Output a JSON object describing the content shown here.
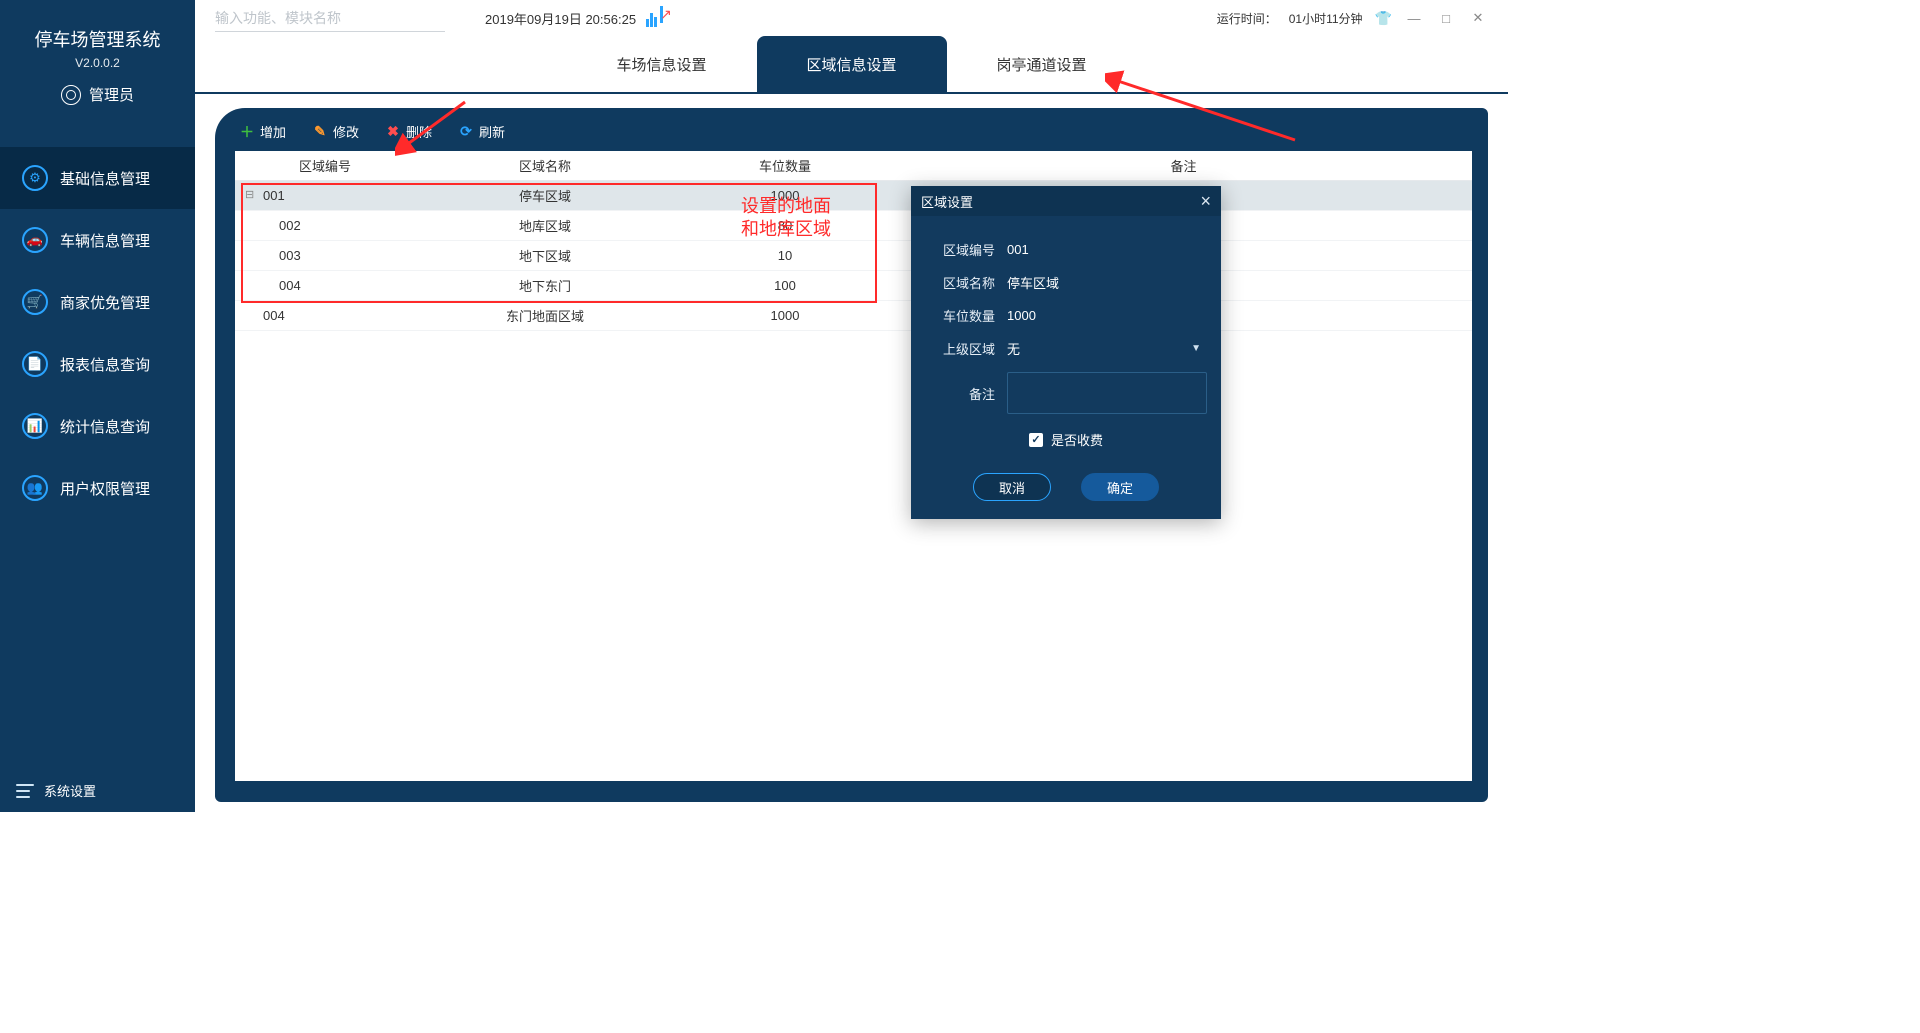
{
  "app": {
    "title": "停车场管理系统",
    "version": "V2.0.0.2",
    "user_role": "管理员"
  },
  "topbar": {
    "search_placeholder": "输入功能、模块名称",
    "datetime": "2019年09月19日 20:56:25",
    "runtime_label": "运行时间：",
    "runtime_value": "01小时11分钟"
  },
  "tabs": {
    "items": [
      "车场信息设置",
      "区域信息设置",
      "岗亭通道设置"
    ],
    "active_index": 1
  },
  "sidebar": {
    "items": [
      {
        "label": "基础信息管理",
        "icon": "gear"
      },
      {
        "label": "车辆信息管理",
        "icon": "car"
      },
      {
        "label": "商家优免管理",
        "icon": "cart"
      },
      {
        "label": "报表信息查询",
        "icon": "report"
      },
      {
        "label": "统计信息查询",
        "icon": "stats"
      },
      {
        "label": "用户权限管理",
        "icon": "users"
      }
    ],
    "active_index": 0,
    "footer_label": "系统设置"
  },
  "toolbar": {
    "add": "增加",
    "edit": "修改",
    "delete": "删除",
    "refresh": "刷新"
  },
  "grid": {
    "columns": [
      "区域编号",
      "区域名称",
      "车位数量",
      "备注"
    ],
    "rows": [
      {
        "id": "001",
        "name": "停车区域",
        "qty": "1000",
        "note": "",
        "selected": true,
        "tree": true
      },
      {
        "id": "002",
        "name": "地库区域",
        "qty": "80",
        "note": "",
        "indent": true
      },
      {
        "id": "003",
        "name": "地下区域",
        "qty": "10",
        "note": "",
        "indent": true
      },
      {
        "id": "004",
        "name": "地下东门",
        "qty": "100",
        "note": "",
        "indent": true
      },
      {
        "id": "004",
        "name": "东门地面区域",
        "qty": "1000",
        "note": ""
      }
    ]
  },
  "dialog": {
    "title": "区域设置",
    "fields": {
      "code_label": "区域编号",
      "code_value": "001",
      "name_label": "区域名称",
      "name_value": "停车区域",
      "qty_label": "车位数量",
      "qty_value": "1000",
      "parent_label": "上级区域",
      "parent_value": "无",
      "note_label": "备注",
      "charge_label": "是否收费",
      "charge_checked": true
    },
    "buttons": {
      "cancel": "取消",
      "ok": "确定"
    }
  },
  "annotations": {
    "note_line1": "设置的地面",
    "note_line2": "和地库区域"
  }
}
